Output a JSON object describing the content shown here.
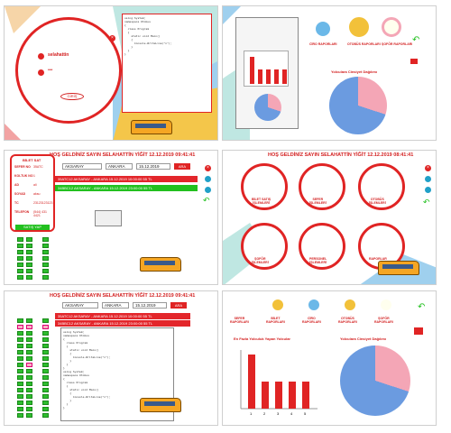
{
  "login": {
    "username": "selahattin",
    "password": "•••",
    "button": "GİRİŞ"
  },
  "top_left_code": [
    "using System;",
    "namespace Otobus",
    "{",
    "  class Program",
    "  {",
    "    static void Main()",
    "    {",
    "      Console.WriteLine(\"x\");",
    "    }",
    "  }",
    "}"
  ],
  "welcome": "HOŞ GELDİNİZ SAYIN SELAHATTİN YİĞİT 12.12.2019 09:41:41",
  "welcome2": "HOŞ GELDİNİZ SAYIN SELAHATTİN YİĞİT 12.12.2019 09:41:41",
  "welcome3": "HOŞ GELDİNİZ SAYIN SELAHATTİN YİĞİT 12.12.2019 08:41:41",
  "search": {
    "from": "AKSARAY",
    "to": "ANKARA",
    "date": "15.12.2019",
    "button": "ARA"
  },
  "trips": [
    {
      "text": "35ATC12 AKSARAY - ANKARA 15.12.2019 10:00:00 55 TL",
      "status": "red"
    },
    {
      "text": "34BBC12 AKSARAY - ANKARA 15.12.2019 23:00:00 55 TL",
      "status": "green"
    }
  ],
  "ticket": {
    "title": "BİLET SAT",
    "rows": [
      [
        "SEFER NO",
        "35ATC"
      ],
      [
        "KOLTUK NO",
        "1"
      ],
      [
        "AD",
        "ali"
      ],
      [
        "SOYAD",
        "aksu"
      ],
      [
        "TC",
        "23123123123"
      ],
      [
        "TELEFON",
        "(544) 431 4421"
      ]
    ],
    "button": "SATIŞ YAP"
  },
  "menu": {
    "items": [
      "BİLET SATIŞ\nİŞLEMLERİ",
      "SEFER\nİŞLEMLERİ",
      "OTOBÜS\nİŞLEMLERİ",
      "ŞOFÖR\nİŞLEMLERİ",
      "PERSONEL\nİŞLEMLERİ",
      "RAPORLAR"
    ]
  },
  "report_tabs": [
    "SEFER\nRAPORLARI",
    "BİLET\nRAPORLARI",
    "CİRO\nRAPORLARI",
    "OTOBÜS\nRAPORLARI",
    "ŞOFÖR\nRAPORLARI"
  ],
  "report_tabs_small": [
    "CİRO\nRAPORLARI",
    "OTOBÜS\nRAPORLARI",
    "ŞOFÖR\nRAPORLARI"
  ],
  "charts": {
    "bar_title": "En Fazla Yolculuk Yapan Yolcular",
    "pie_title": "Yolculara Cinsiyet Dağılımı",
    "pie_title_small": "Yolculara Cinsiyet Dağılımı"
  },
  "chart_data": [
    {
      "type": "bar",
      "title": "En Fazla Yolculuk Yapan Yolcular",
      "categories": [
        "1",
        "2",
        "3",
        "4",
        "5"
      ],
      "values": [
        2,
        1,
        1,
        1,
        1
      ],
      "ylim": [
        0,
        2
      ]
    },
    {
      "type": "pie",
      "title": "Yolculara Cinsiyet Dağılımı",
      "slices": [
        {
          "value": 0.3,
          "color": "#f4a6b6"
        },
        {
          "value": 0.7,
          "color": "#6b9be0"
        }
      ]
    }
  ],
  "colors": {
    "accent": "#e02424",
    "green": "#22c01f",
    "pink": "#f4a6b6",
    "blue": "#6b9be0"
  }
}
